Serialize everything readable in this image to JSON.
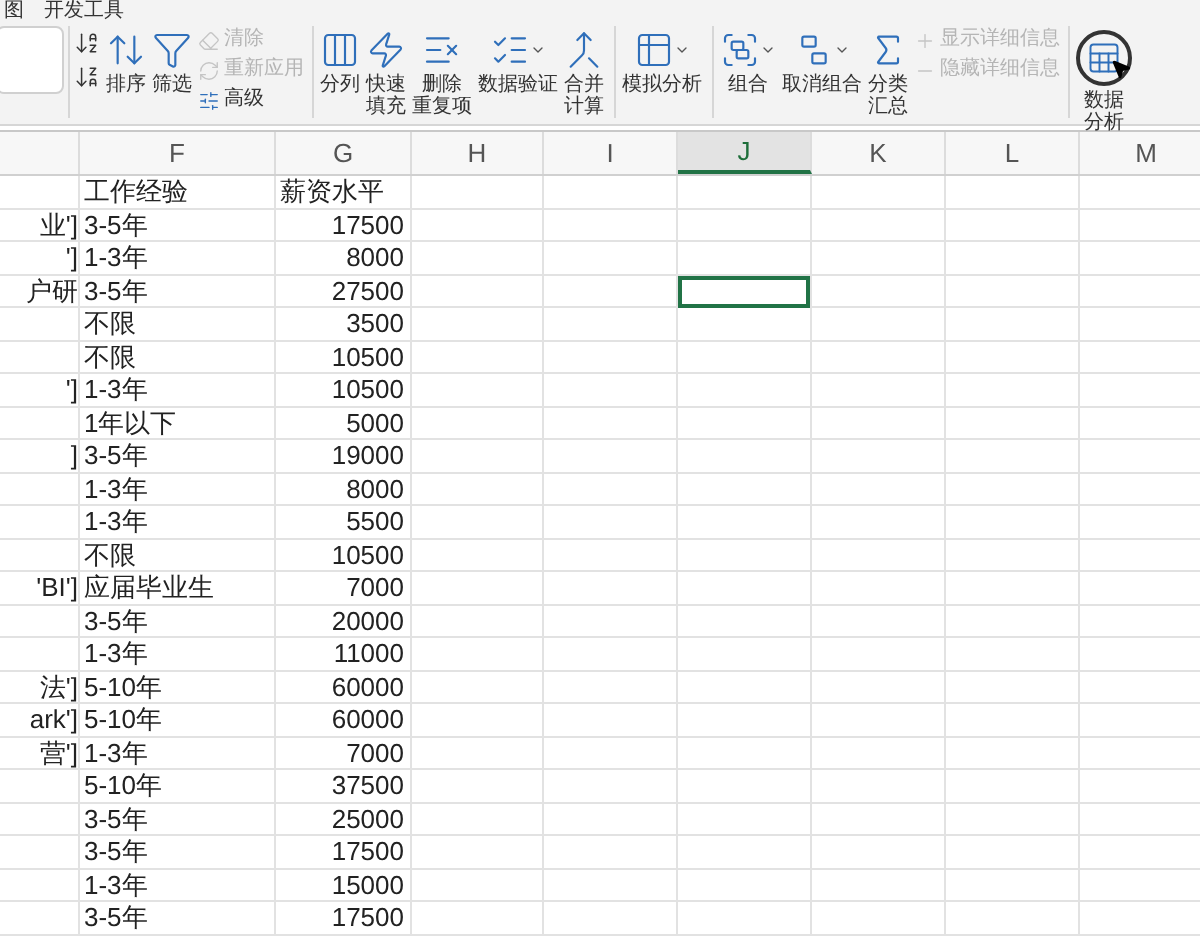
{
  "menu_tabs": [
    {
      "label": "图"
    },
    {
      "label": "开发工具"
    }
  ],
  "ribbon": {
    "groups": [
      {
        "items": [
          {
            "kind": "large",
            "lines": [
              "排序"
            ],
            "dropdown": false
          },
          {
            "kind": "large",
            "lines": [
              "筛选"
            ],
            "dropdown": false
          },
          {
            "kind": "small",
            "label": "清除",
            "disabled": true
          },
          {
            "kind": "small",
            "label": "重新应用",
            "disabled": true
          },
          {
            "kind": "small",
            "label": "高级",
            "disabled": false
          }
        ]
      },
      {
        "items": [
          {
            "kind": "large",
            "lines": [
              "分列"
            ],
            "dropdown": false
          },
          {
            "kind": "large",
            "lines": [
              "快速",
              "填充"
            ],
            "dropdown": false
          },
          {
            "kind": "large",
            "lines": [
              "删除",
              "重复项"
            ],
            "dropdown": false
          },
          {
            "kind": "large",
            "lines": [
              "数据验证"
            ],
            "dropdown": true
          },
          {
            "kind": "large",
            "lines": [
              "合并",
              "计算"
            ],
            "dropdown": false
          }
        ]
      },
      {
        "items": [
          {
            "kind": "large",
            "lines": [
              "模拟分析"
            ],
            "dropdown": true
          }
        ]
      },
      {
        "items": [
          {
            "kind": "large",
            "lines": [
              "组合"
            ],
            "dropdown": true
          },
          {
            "kind": "large",
            "lines": [
              "取消组合"
            ],
            "dropdown": true
          },
          {
            "kind": "large",
            "lines": [
              "分类",
              "汇总"
            ],
            "dropdown": false
          },
          {
            "kind": "small",
            "label": "显示详细信息",
            "disabled": true
          },
          {
            "kind": "small",
            "label": "隐藏详细信息",
            "disabled": true
          }
        ]
      },
      {
        "items": [
          {
            "kind": "large",
            "lines": [
              "数据",
              "分析"
            ],
            "dropdown": false
          }
        ]
      }
    ]
  },
  "sheet": {
    "columns": [
      {
        "label": "F",
        "selected": false
      },
      {
        "label": "G",
        "selected": false
      },
      {
        "label": "H",
        "selected": false
      },
      {
        "label": "I",
        "selected": false
      },
      {
        "label": "J",
        "selected": true
      },
      {
        "label": "K",
        "selected": false
      },
      {
        "label": "L",
        "selected": false
      },
      {
        "label": "M",
        "selected": false
      }
    ],
    "rows": [
      {
        "column_e": "",
        "f": "工作经验",
        "g": "薪资水平",
        "j_selected": false
      },
      {
        "column_e": "业']",
        "f": "3-5年",
        "g": "17500",
        "j_selected": false
      },
      {
        "column_e": "']",
        "f": "1-3年",
        "g": "8000",
        "j_selected": false
      },
      {
        "column_e": "户研",
        "f": "3-5年",
        "g": "27500",
        "j_selected": true
      },
      {
        "column_e": "",
        "f": "不限",
        "g": "3500",
        "j_selected": false
      },
      {
        "column_e": "",
        "f": "不限",
        "g": "10500",
        "j_selected": false
      },
      {
        "column_e": "']",
        "f": "1-3年",
        "g": "10500",
        "j_selected": false
      },
      {
        "column_e": "",
        "f": "1年以下",
        "g": "5000",
        "j_selected": false
      },
      {
        "column_e": "]",
        "f": "3-5年",
        "g": "19000",
        "j_selected": false
      },
      {
        "column_e": "",
        "f": "1-3年",
        "g": "8000",
        "j_selected": false
      },
      {
        "column_e": "",
        "f": "1-3年",
        "g": "5500",
        "j_selected": false
      },
      {
        "column_e": "",
        "f": "不限",
        "g": "10500",
        "j_selected": false
      },
      {
        "column_e": "'BI']",
        "f": "应届毕业生",
        "g": "7000",
        "j_selected": false
      },
      {
        "column_e": "",
        "f": "3-5年",
        "g": "20000",
        "j_selected": false
      },
      {
        "column_e": "",
        "f": "1-3年",
        "g": "11000",
        "j_selected": false
      },
      {
        "column_e": "法']",
        "f": "5-10年",
        "g": "60000",
        "j_selected": false
      },
      {
        "column_e": "ark']",
        "f": "5-10年",
        "g": "60000",
        "j_selected": false
      },
      {
        "column_e": "营']",
        "f": "1-3年",
        "g": "7000",
        "j_selected": false
      },
      {
        "column_e": "",
        "f": "5-10年",
        "g": "37500",
        "j_selected": false
      },
      {
        "column_e": "",
        "f": "3-5年",
        "g": "25000",
        "j_selected": false
      },
      {
        "column_e": "",
        "f": "3-5年",
        "g": "17500",
        "j_selected": false
      },
      {
        "column_e": "",
        "f": "1-3年",
        "g": "15000",
        "j_selected": false
      },
      {
        "column_e": "",
        "f": "3-5年",
        "g": "17500",
        "j_selected": false
      }
    ]
  }
}
